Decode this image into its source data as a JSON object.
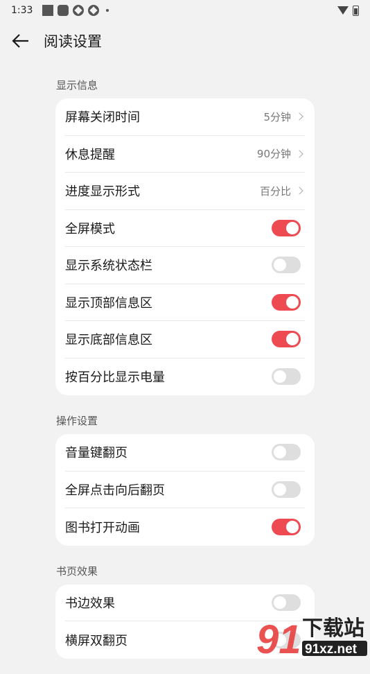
{
  "status_bar": {
    "time": "1:33"
  },
  "header": {
    "title": "阅读设置"
  },
  "sections": [
    {
      "label": "显示信息",
      "items": [
        {
          "label": "屏幕关闭时间",
          "type": "nav",
          "value": "5分钟"
        },
        {
          "label": "休息提醒",
          "type": "nav",
          "value": "90分钟"
        },
        {
          "label": "进度显示形式",
          "type": "nav",
          "value": "百分比"
        },
        {
          "label": "全屏模式",
          "type": "toggle",
          "on": true
        },
        {
          "label": "显示系统状态栏",
          "type": "toggle",
          "on": false
        },
        {
          "label": "显示顶部信息区",
          "type": "toggle",
          "on": true
        },
        {
          "label": "显示底部信息区",
          "type": "toggle",
          "on": true
        },
        {
          "label": "按百分比显示电量",
          "type": "toggle",
          "on": false
        }
      ]
    },
    {
      "label": "操作设置",
      "items": [
        {
          "label": "音量键翻页",
          "type": "toggle",
          "on": false
        },
        {
          "label": "全屏点击向后翻页",
          "type": "toggle",
          "on": false
        },
        {
          "label": "图书打开动画",
          "type": "toggle",
          "on": true
        }
      ]
    },
    {
      "label": "书页效果",
      "items": [
        {
          "label": "书边效果",
          "type": "toggle",
          "on": false
        },
        {
          "label": "横屏双翻页",
          "type": "toggle",
          "on": false
        }
      ]
    }
  ],
  "watermark": {
    "text_top": "下载站",
    "text_bottom": "91xz.net",
    "logo": "91"
  },
  "colors": {
    "accent": "#ee4a52",
    "background": "#f2f2f2",
    "card": "#ffffff"
  }
}
